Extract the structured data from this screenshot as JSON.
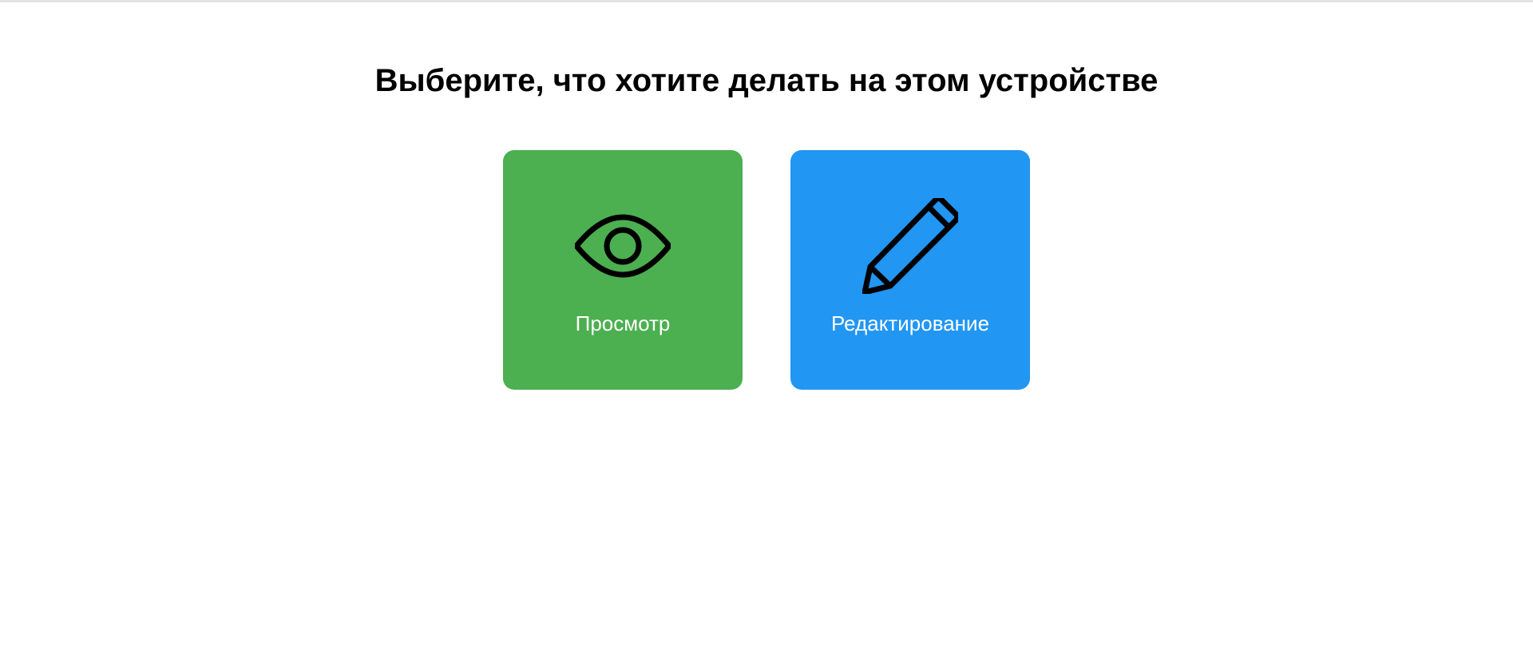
{
  "page": {
    "title": "Выберите, что хотите делать на этом устройстве"
  },
  "modes": [
    {
      "label": "Просмотр",
      "icon": "eye-icon",
      "color": "#4caf50"
    },
    {
      "label": "Редактирование",
      "icon": "pencil-icon",
      "color": "#2196f3"
    }
  ]
}
